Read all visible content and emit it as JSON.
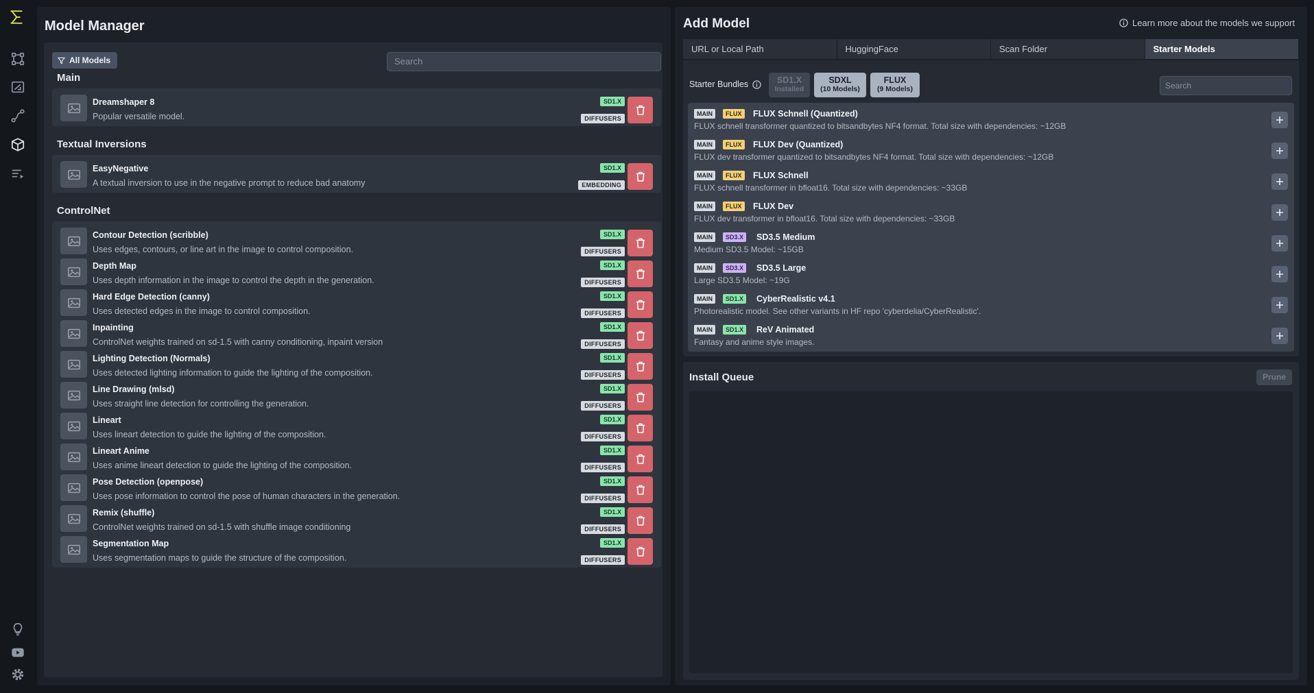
{
  "rail": {
    "items": [
      "logo-icon",
      "workflow-icon",
      "canvas-icon",
      "nodes-icon",
      "models-icon",
      "queue-icon",
      "lightbulb-icon",
      "youtube-icon",
      "settings-icon"
    ]
  },
  "manager": {
    "title": "Model Manager",
    "filter_label": "All Models",
    "search_placeholder": "Search",
    "sections": [
      {
        "title": "Main",
        "rows": [
          {
            "name": "Dreamshaper 8",
            "desc": "Popular versatile model.",
            "base": "SD1.X",
            "format": "DIFFUSERS"
          }
        ]
      },
      {
        "title": "Textual Inversions",
        "rows": [
          {
            "name": "EasyNegative",
            "desc": "A textual inversion to use in the negative prompt to reduce bad anatomy",
            "base": "SD1.X",
            "format": "EMBEDDING"
          }
        ]
      },
      {
        "title": "ControlNet",
        "rows": [
          {
            "name": "Contour Detection (scribble)",
            "desc": "Uses edges, contours, or line art in the image to control composition.",
            "base": "SD1.X",
            "format": "DIFFUSERS"
          },
          {
            "name": "Depth Map",
            "desc": "Uses depth information in the image to control the depth in the generation.",
            "base": "SD1.X",
            "format": "DIFFUSERS"
          },
          {
            "name": "Hard Edge Detection (canny)",
            "desc": "Uses detected edges in the image to control composition.",
            "base": "SD1.X",
            "format": "DIFFUSERS"
          },
          {
            "name": "Inpainting",
            "desc": "ControlNet weights trained on sd-1.5 with canny conditioning, inpaint version",
            "base": "SD1.X",
            "format": "DIFFUSERS"
          },
          {
            "name": "Lighting Detection (Normals)",
            "desc": "Uses detected lighting information to guide the lighting of the composition.",
            "base": "SD1.X",
            "format": "DIFFUSERS"
          },
          {
            "name": "Line Drawing (mlsd)",
            "desc": "Uses straight line detection for controlling the generation.",
            "base": "SD1.X",
            "format": "DIFFUSERS"
          },
          {
            "name": "Lineart",
            "desc": "Uses lineart detection to guide the lighting of the composition.",
            "base": "SD1.X",
            "format": "DIFFUSERS"
          },
          {
            "name": "Lineart Anime",
            "desc": "Uses anime lineart detection to guide the lighting of the composition.",
            "base": "SD1.X",
            "format": "DIFFUSERS"
          },
          {
            "name": "Pose Detection (openpose)",
            "desc": "Uses pose information to control the pose of human characters in the generation.",
            "base": "SD1.X",
            "format": "DIFFUSERS"
          },
          {
            "name": "Remix (shuffle)",
            "desc": "ControlNet weights trained on sd-1.5 with shuffle image conditioning",
            "base": "SD1.X",
            "format": "DIFFUSERS"
          },
          {
            "name": "Segmentation Map",
            "desc": "Uses segmentation maps to guide the structure of the composition.",
            "base": "SD1.X",
            "format": "DIFFUSERS"
          }
        ]
      }
    ]
  },
  "add_model": {
    "title": "Add Model",
    "learn_more": "Learn more about the models we support",
    "tabs": [
      "URL or Local Path",
      "HuggingFace",
      "Scan Folder",
      "Starter Models"
    ],
    "active_tab": "Starter Models",
    "bundles_label": "Starter Bundles",
    "bundles": [
      {
        "name": "SD1.X",
        "sub": "Installed",
        "state": "installed"
      },
      {
        "name": "SDXL",
        "sub": "(10 Models)",
        "state": "available"
      },
      {
        "name": "FLUX",
        "sub": "(9 Models)",
        "state": "available"
      }
    ],
    "search_placeholder": "Search",
    "starters": [
      {
        "type": "MAIN",
        "base": "FLUX",
        "name": "FLUX Schnell (Quantized)",
        "desc": "FLUX schnell transformer quantized to bitsandbytes NF4 format. Total size with dependencies: ~12GB"
      },
      {
        "type": "MAIN",
        "base": "FLUX",
        "name": "FLUX Dev (Quantized)",
        "desc": "FLUX dev transformer quantized to bitsandbytes NF4 format. Total size with dependencies: ~12GB"
      },
      {
        "type": "MAIN",
        "base": "FLUX",
        "name": "FLUX Schnell",
        "desc": "FLUX schnell transformer in bfloat16. Total size with dependencies: ~33GB"
      },
      {
        "type": "MAIN",
        "base": "FLUX",
        "name": "FLUX Dev",
        "desc": "FLUX dev transformer in bfloat16. Total size with dependencies: ~33GB"
      },
      {
        "type": "MAIN",
        "base": "SD3.X",
        "name": "SD3.5 Medium",
        "desc": "Medium SD3.5 Model: ~15GB"
      },
      {
        "type": "MAIN",
        "base": "SD3.X",
        "name": "SD3.5 Large",
        "desc": "Large SD3.5 Model: ~19G"
      },
      {
        "type": "MAIN",
        "base": "SD1.X",
        "name": "CyberRealistic v4.1",
        "desc": "Photorealistic model. See other variants in HF repo 'cyberdelia/CyberRealistic'."
      },
      {
        "type": "MAIN",
        "base": "SD1.X",
        "name": "ReV Animated",
        "desc": "Fantasy and anime style images."
      }
    ]
  },
  "queue": {
    "title": "Install Queue",
    "prune_label": "Prune"
  },
  "colors": {
    "accent_logo": "#d6e141",
    "delete": "#d4646a",
    "badge_sd1": "#8be3ab",
    "badge_flux": "#f3cf78",
    "badge_sd3": "#cbb3f1"
  }
}
